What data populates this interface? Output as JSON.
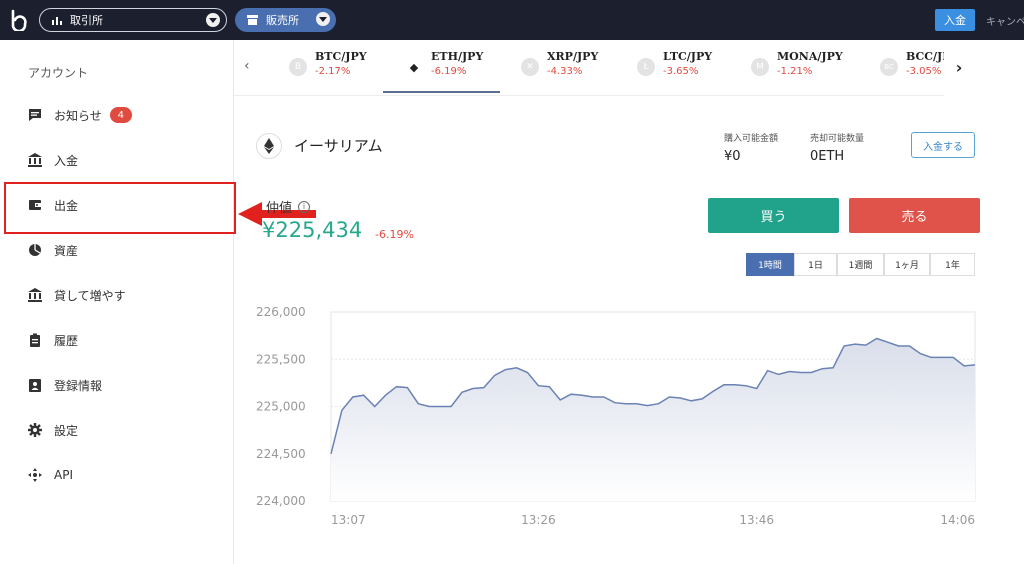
{
  "topbar": {
    "exchange_label": "取引所",
    "shop_label": "販売所",
    "deposit_label": "入金",
    "campaign_label": "キャンペ"
  },
  "sidebar": {
    "title": "アカウント",
    "items": [
      {
        "label": "お知らせ",
        "icon": "message-icon",
        "badge": "4"
      },
      {
        "label": "入金",
        "icon": "bank-icon"
      },
      {
        "label": "出金",
        "icon": "wallet-icon"
      },
      {
        "label": "資産",
        "icon": "pie-chart-icon"
      },
      {
        "label": "貸して増やす",
        "icon": "bank-icon"
      },
      {
        "label": "履歴",
        "icon": "clipboard-icon"
      },
      {
        "label": "登録情報",
        "icon": "id-card-icon"
      },
      {
        "label": "設定",
        "icon": "gear-icon"
      },
      {
        "label": "API",
        "icon": "api-icon"
      }
    ]
  },
  "tabs": [
    {
      "name": "BTC/JPY",
      "change": "-2.17%",
      "icon": "B"
    },
    {
      "name": "ETH/JPY",
      "change": "-6.19%",
      "icon": "◆"
    },
    {
      "name": "XRP/JPY",
      "change": "-4.33%",
      "icon": "✕"
    },
    {
      "name": "LTC/JPY",
      "change": "-3.65%",
      "icon": "Ł"
    },
    {
      "name": "MONA/JPY",
      "change": "-1.21%",
      "icon": "M"
    },
    {
      "name": "BCC/JP",
      "change": "-3.05%",
      "icon": "BC"
    }
  ],
  "coin": {
    "title": "イーサリアム",
    "buyable_label": "購入可能金額",
    "buyable_value": "¥0",
    "sellable_label": "売却可能数量",
    "sellable_value": "0ETH",
    "deposit_button": "入金する",
    "mid_label": "仲値",
    "price": "¥225,434",
    "price_change": "-6.19%",
    "buy_button": "買う",
    "sell_button": "売る"
  },
  "ranges": [
    "1時間",
    "1日",
    "1週間",
    "1ヶ月",
    "1年"
  ],
  "colors": {
    "accent": "#4a6fb0",
    "buy": "#21a28a",
    "sell": "#e0534a",
    "negative": "#e04a3f"
  },
  "chart_data": {
    "type": "area",
    "title": "",
    "xlabel": "",
    "ylabel": "",
    "x_ticks": [
      "13:07",
      "13:26",
      "13:46",
      "14:06"
    ],
    "y_ticks": [
      "226,000",
      "225,500",
      "225,000",
      "224,500",
      "224,000"
    ],
    "ylim": [
      224000,
      226000
    ],
    "xlim": [
      0,
      59
    ],
    "x": [
      0,
      1,
      2,
      3,
      4,
      5,
      6,
      7,
      8,
      9,
      10,
      11,
      12,
      13,
      14,
      15,
      16,
      17,
      18,
      19,
      20,
      21,
      22,
      23,
      24,
      25,
      26,
      27,
      28,
      29,
      30,
      31,
      32,
      33,
      34,
      35,
      36,
      37,
      38,
      39,
      40,
      41,
      42,
      43,
      44,
      45,
      46,
      47,
      48,
      49,
      50,
      51,
      52,
      53,
      54,
      55,
      56,
      57,
      58,
      59
    ],
    "series": [
      {
        "values": [
          224500,
          224960,
          225100,
          225120,
          225000,
          225120,
          225210,
          225200,
          225030,
          225000,
          225000,
          225000,
          225150,
          225190,
          225200,
          225330,
          225390,
          225410,
          225360,
          225220,
          225210,
          225070,
          225130,
          225120,
          225100,
          225100,
          225040,
          225030,
          225030,
          225010,
          225030,
          225100,
          225090,
          225060,
          225080,
          225160,
          225230,
          225230,
          225220,
          225190,
          225380,
          225340,
          225370,
          225360,
          225360,
          225400,
          225410,
          225640,
          225660,
          225650,
          225720,
          225680,
          225640,
          225640,
          225560,
          225520,
          225520,
          225520,
          225430,
          225440
        ]
      }
    ]
  }
}
